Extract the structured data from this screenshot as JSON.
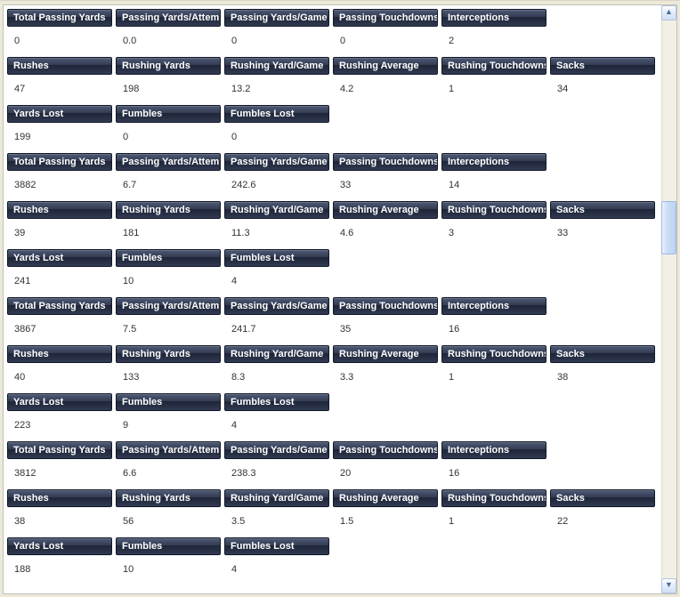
{
  "columns": {
    "passing": [
      "Total Passing Yards",
      "Passing Yards/Attemp",
      "Passing Yards/Game",
      "Passing Touchdowns",
      "Interceptions"
    ],
    "rushing": [
      "Rushes",
      "Rushing Yards",
      "Rushing Yard/Game",
      "Rushing Average",
      "Rushing Touchdowns",
      "Sacks"
    ],
    "misc": [
      "Yards Lost",
      "Fumbles",
      "Fumbles Lost"
    ]
  },
  "records": [
    {
      "passing": [
        "0",
        "0.0",
        "0",
        "0",
        "2"
      ],
      "rushing": [
        "47",
        "198",
        "13.2",
        "4.2",
        "1",
        "34"
      ],
      "misc": [
        "199",
        "0",
        "0"
      ]
    },
    {
      "passing": [
        "3882",
        "6.7",
        "242.6",
        "33",
        "14"
      ],
      "rushing": [
        "39",
        "181",
        "11.3",
        "4.6",
        "3",
        "33"
      ],
      "misc": [
        "241",
        "10",
        "4"
      ]
    },
    {
      "passing": [
        "3867",
        "7.5",
        "241.7",
        "35",
        "16"
      ],
      "rushing": [
        "40",
        "133",
        "8.3",
        "3.3",
        "1",
        "38"
      ],
      "misc": [
        "223",
        "9",
        "4"
      ]
    },
    {
      "passing": [
        "3812",
        "6.6",
        "238.3",
        "20",
        "16"
      ],
      "rushing": [
        "38",
        "56",
        "3.5",
        "1.5",
        "1",
        "22"
      ],
      "misc": [
        "188",
        "10",
        "4"
      ]
    }
  ]
}
